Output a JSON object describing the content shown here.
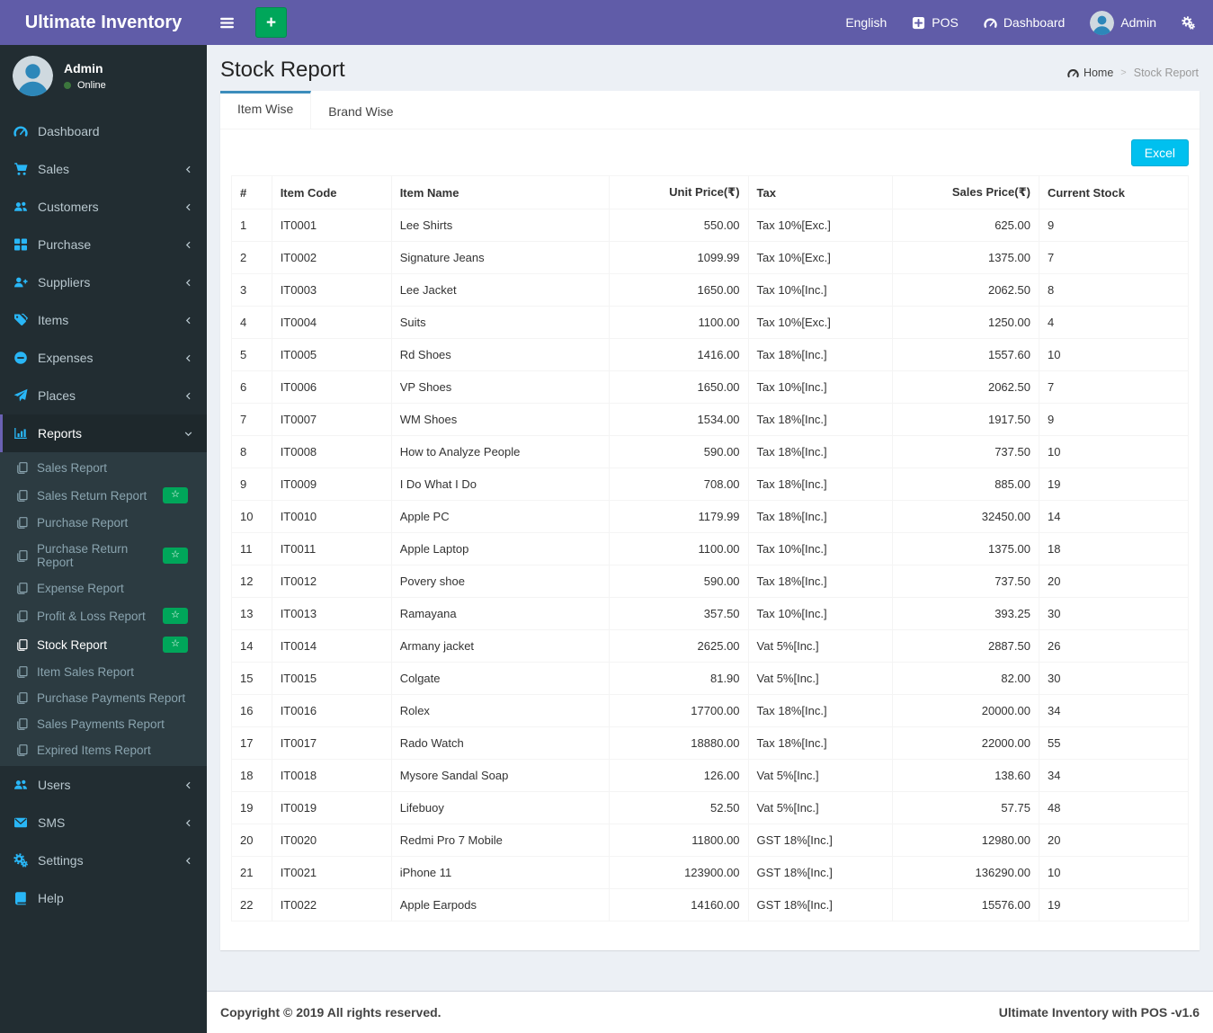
{
  "colors": {
    "topbar_purple": "#605ca8",
    "add_green": "#00a65a",
    "badge_green": "#00a65a",
    "excel_cyan": "#00c0ef",
    "tab_accent": "#3c8dbc",
    "sidebar_bg": "#222d32",
    "submenu_bg": "#2c3b41",
    "icon_blue": "#29b6f6"
  },
  "topbar": {
    "brand": "Ultimate Inventory",
    "menu_icon": "hamburger-icon",
    "add_label": "+",
    "right": [
      {
        "label": "English",
        "icon": null
      },
      {
        "label": "POS",
        "icon": "plus-square-icon"
      },
      {
        "label": "Dashboard",
        "icon": "tachometer-icon"
      },
      {
        "label": "Admin",
        "icon": "user-avatar-icon"
      },
      {
        "label": "",
        "icon": "cogs-icon"
      }
    ]
  },
  "sidebar": {
    "user": {
      "name": "Admin",
      "status": "Online",
      "status_icon": "online-dot"
    },
    "items": [
      {
        "label": "Dashboard",
        "icon": "tachometer-icon"
      },
      {
        "label": "Sales",
        "icon": "cart-icon",
        "chevron": "left"
      },
      {
        "label": "Customers",
        "icon": "users-icon",
        "chevron": "left"
      },
      {
        "label": "Purchase",
        "icon": "th-large-icon",
        "chevron": "left"
      },
      {
        "label": "Suppliers",
        "icon": "user-plus-icon",
        "chevron": "left"
      },
      {
        "label": "Items",
        "icon": "tags-icon",
        "chevron": "left"
      },
      {
        "label": "Expenses",
        "icon": "minus-circle-icon",
        "chevron": "left"
      },
      {
        "label": "Places",
        "icon": "paper-plane-icon",
        "chevron": "left"
      },
      {
        "label": "Reports",
        "icon": "bar-chart-icon",
        "chevron": "down",
        "active": true,
        "submenu": [
          {
            "label": "Sales Report",
            "icon": "copy-icon"
          },
          {
            "label": "Sales Return Report",
            "icon": "copy-icon",
            "badge": "☆"
          },
          {
            "label": "Purchase Report",
            "icon": "copy-icon"
          },
          {
            "label": "Purchase Return Report",
            "icon": "copy-icon",
            "badge": "☆"
          },
          {
            "label": "Expense Report",
            "icon": "copy-icon"
          },
          {
            "label": "Profit & Loss Report",
            "icon": "copy-icon",
            "badge": "☆"
          },
          {
            "label": "Stock Report",
            "icon": "copy-icon",
            "badge": "☆",
            "active": true
          },
          {
            "label": "Item Sales Report",
            "icon": "copy-icon"
          },
          {
            "label": "Purchase Payments Report",
            "icon": "copy-icon"
          },
          {
            "label": "Sales Payments Report",
            "icon": "copy-icon"
          },
          {
            "label": "Expired Items Report",
            "icon": "copy-icon"
          }
        ]
      },
      {
        "label": "Users",
        "icon": "users-icon",
        "chevron": "left"
      },
      {
        "label": "SMS",
        "icon": "envelope-icon",
        "chevron": "left"
      },
      {
        "label": "Settings",
        "icon": "cogs-icon",
        "chevron": "left"
      },
      {
        "label": "Help",
        "icon": "book-icon"
      }
    ]
  },
  "page": {
    "title": "Stock Report",
    "breadcrumb": {
      "home_icon": "tachometer-icon",
      "home": "Home",
      "separator": ">",
      "current": "Stock Report"
    },
    "tabs": [
      {
        "label": "Item Wise",
        "active": true
      },
      {
        "label": "Brand Wise",
        "active": false
      }
    ],
    "export_button": "Excel"
  },
  "table": {
    "headers": [
      "#",
      "Item Code",
      "Item Name",
      "Unit Price(₹)",
      "Tax",
      "Sales Price(₹)",
      "Current Stock"
    ],
    "rows": [
      [
        "1",
        "IT0001",
        "Lee Shirts",
        "550.00",
        "Tax 10%[Exc.]",
        "625.00",
        "9"
      ],
      [
        "2",
        "IT0002",
        "Signature Jeans",
        "1099.99",
        "Tax 10%[Exc.]",
        "1375.00",
        "7"
      ],
      [
        "3",
        "IT0003",
        "Lee Jacket",
        "1650.00",
        "Tax 10%[Inc.]",
        "2062.50",
        "8"
      ],
      [
        "4",
        "IT0004",
        "Suits",
        "1100.00",
        "Tax 10%[Exc.]",
        "1250.00",
        "4"
      ],
      [
        "5",
        "IT0005",
        "Rd Shoes",
        "1416.00",
        "Tax 18%[Inc.]",
        "1557.60",
        "10"
      ],
      [
        "6",
        "IT0006",
        "VP Shoes",
        "1650.00",
        "Tax 10%[Inc.]",
        "2062.50",
        "7"
      ],
      [
        "7",
        "IT0007",
        "WM Shoes",
        "1534.00",
        "Tax 18%[Inc.]",
        "1917.50",
        "9"
      ],
      [
        "8",
        "IT0008",
        "How to Analyze People",
        "590.00",
        "Tax 18%[Inc.]",
        "737.50",
        "10"
      ],
      [
        "9",
        "IT0009",
        "I Do What I Do",
        "708.00",
        "Tax 18%[Inc.]",
        "885.00",
        "19"
      ],
      [
        "10",
        "IT0010",
        "Apple PC",
        "1179.99",
        "Tax 18%[Inc.]",
        "32450.00",
        "14"
      ],
      [
        "11",
        "IT0011",
        "Apple Laptop",
        "1100.00",
        "Tax 10%[Inc.]",
        "1375.00",
        "18"
      ],
      [
        "12",
        "IT0012",
        "Povery shoe",
        "590.00",
        "Tax 18%[Inc.]",
        "737.50",
        "20"
      ],
      [
        "13",
        "IT0013",
        "Ramayana",
        "357.50",
        "Tax 10%[Inc.]",
        "393.25",
        "30"
      ],
      [
        "14",
        "IT0014",
        "Armany jacket",
        "2625.00",
        "Vat 5%[Inc.]",
        "2887.50",
        "26"
      ],
      [
        "15",
        "IT0015",
        "Colgate",
        "81.90",
        "Vat 5%[Inc.]",
        "82.00",
        "30"
      ],
      [
        "16",
        "IT0016",
        "Rolex",
        "17700.00",
        "Tax 18%[Inc.]",
        "20000.00",
        "34"
      ],
      [
        "17",
        "IT0017",
        "Rado Watch",
        "18880.00",
        "Tax 18%[Inc.]",
        "22000.00",
        "55"
      ],
      [
        "18",
        "IT0018",
        "Mysore Sandal Soap",
        "126.00",
        "Vat 5%[Inc.]",
        "138.60",
        "34"
      ],
      [
        "19",
        "IT0019",
        "Lifebuoy",
        "52.50",
        "Vat 5%[Inc.]",
        "57.75",
        "48"
      ],
      [
        "20",
        "IT0020",
        "Redmi Pro 7 Mobile",
        "11800.00",
        "GST 18%[Inc.]",
        "12980.00",
        "20"
      ],
      [
        "21",
        "IT0021",
        "iPhone 11",
        "123900.00",
        "GST 18%[Inc.]",
        "136290.00",
        "10"
      ],
      [
        "22",
        "IT0022",
        "Apple Earpods",
        "14160.00",
        "GST 18%[Inc.]",
        "15576.00",
        "19"
      ]
    ]
  },
  "footer": {
    "left": "Copyright © 2019 All rights reserved.",
    "right": "Ultimate Inventory with POS -v1.6"
  }
}
